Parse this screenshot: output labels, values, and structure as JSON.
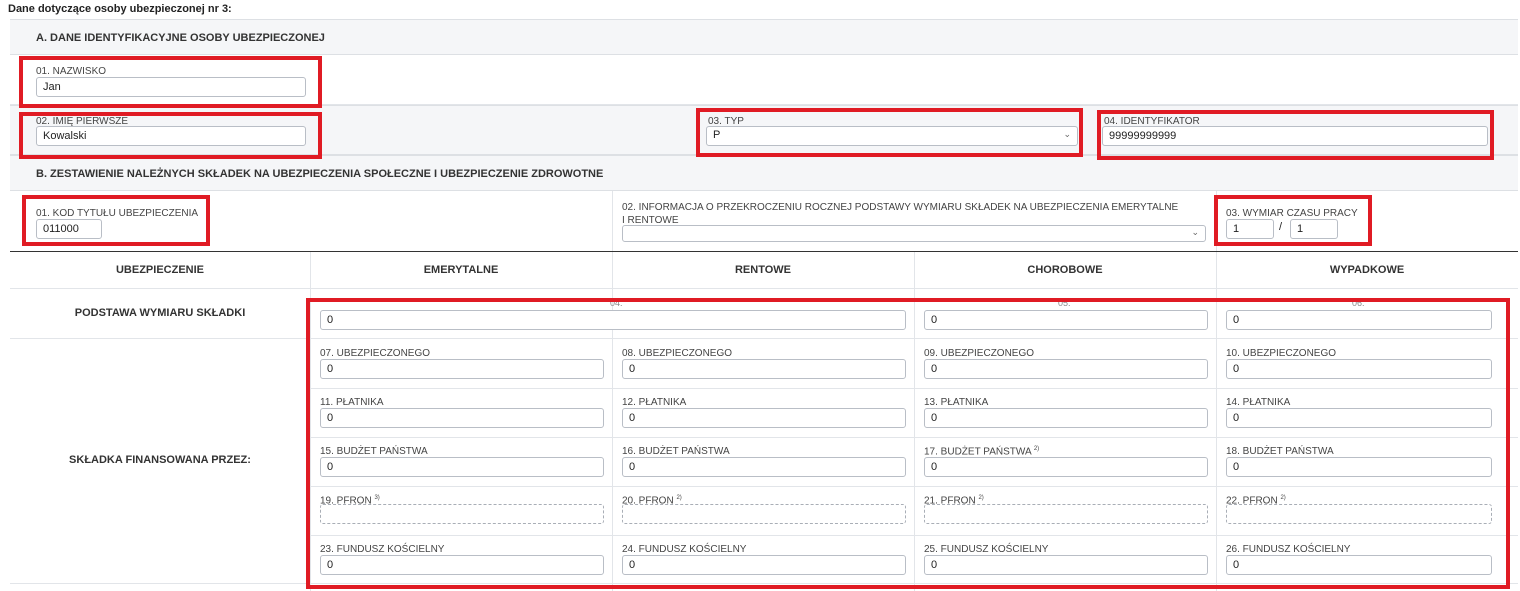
{
  "page_title": "Dane dotyczące osoby ubezpieczonej nr 3:",
  "section_a": {
    "title": "A. DANE IDENTYFIKACYJNE OSOBY UBEZPIECZONEJ",
    "nazwisko_label": "01. NAZWISKO",
    "nazwisko_value": "Jan",
    "imie_label": "02. IMIĘ PIERWSZE",
    "imie_value": "Kowalski",
    "typ_label": "03. TYP",
    "typ_value": "P",
    "identyfikator_label": "04. IDENTYFIKATOR",
    "identyfikator_value": "99999999999"
  },
  "section_b": {
    "title": "B. ZESTAWIENIE NALEŻNYCH SKŁADEK NA UBEZPIECZENIA SPOŁECZNE I UBEZPIECZENIE ZDROWOTNE",
    "kod_label": "01. KOD TYTUŁU UBEZPIECZENIA",
    "kod_value": "011000",
    "info_label": "02. INFORMACJA O PRZEKROCZENIU ROCZNEJ PODSTAWY WYMIARU SKŁADEK NA UBEZPIECZENIA EMERYTALNE I RENTOWE",
    "info_value": "",
    "wymiar_label": "03. WYMIAR CZASU PRACY",
    "wymiar_num": "1",
    "wymiar_sep": "/",
    "wymiar_den": "1"
  },
  "table": {
    "headers": [
      "UBEZPIECZENIE",
      "EMERYTALNE",
      "RENTOWE",
      "CHOROBOWE",
      "WYPADKOWE"
    ],
    "podstawa_label": "PODSTAWA WYMIARU SKŁADKI",
    "podstawa_emer_rent": "0",
    "podstawa_chor": "0",
    "podstawa_wyp": "0",
    "faint_04": "04.",
    "faint_05": "05.",
    "faint_06": "06.",
    "skladka_label": "SKŁADKA FINANSOWANA PRZEZ:",
    "rows": [
      {
        "labels": [
          "07. UBEZPIECZONEGO",
          "08. UBEZPIECZONEGO",
          "09. UBEZPIECZONEGO",
          "10. UBEZPIECZONEGO"
        ],
        "values": [
          "0",
          "0",
          "0",
          "0"
        ]
      },
      {
        "labels": [
          "11. PŁATNIKA",
          "12. PŁATNIKA",
          "13. PŁATNIKA",
          "14. PŁATNIKA"
        ],
        "values": [
          "0",
          "0",
          "0",
          "0"
        ]
      },
      {
        "labels": [
          "15. BUDŻET PAŃSTWA",
          "16. BUDŻET PAŃSTWA",
          "17. BUDŻET PAŃSTWA",
          "18. BUDŻET PAŃSTWA"
        ],
        "sups": [
          "",
          "",
          "2)",
          ""
        ],
        "values": [
          "0",
          "0",
          "0",
          "0"
        ]
      },
      {
        "labels": [
          "19. PFRON",
          "20. PFRON",
          "21. PFRON",
          "22. PFRON"
        ],
        "sups": [
          "3)",
          "2)",
          "2)",
          "2)"
        ],
        "values": [
          "",
          "",
          "",
          ""
        ]
      },
      {
        "labels": [
          "23. FUNDUSZ KOŚCIELNY",
          "24. FUNDUSZ KOŚCIELNY",
          "25. FUNDUSZ KOŚCIELNY",
          "26. FUNDUSZ KOŚCIELNY"
        ],
        "values": [
          "0",
          "0",
          "0",
          "0"
        ]
      }
    ]
  },
  "colors": {
    "highlight": "#e01b24",
    "band": "#f5f6f8",
    "border": "#b9bec6"
  },
  "icons": {
    "select_chevron": "chevron-down-icon"
  }
}
